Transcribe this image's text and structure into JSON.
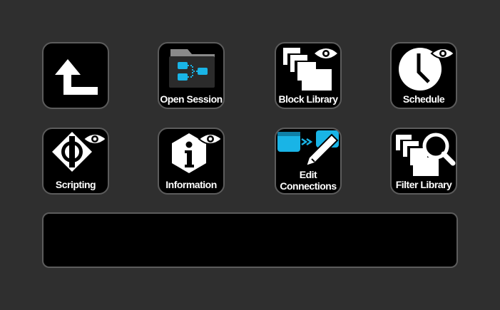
{
  "buttons": {
    "back": {
      "icon": "back-arrow-icon"
    },
    "open_session": {
      "label": "Open Session",
      "icon": "folder-flow-icon"
    },
    "block_library": {
      "label": "Block Library",
      "icon": "stacked-blocks-eye-icon"
    },
    "schedule": {
      "label": "Schedule",
      "icon": "clock-eye-icon"
    },
    "scripting": {
      "label": "Scripting",
      "icon": "script-eye-icon"
    },
    "information": {
      "label": "Information",
      "icon": "info-eye-icon"
    },
    "edit_connections": {
      "label_line1": "Edit",
      "label_line2": "Connections",
      "icon": "connections-pencil-icon"
    },
    "filter_library": {
      "label": "Filter Library",
      "icon": "stacked-blocks-magnifier-icon"
    }
  },
  "colors": {
    "background": "#2f2f2f",
    "key_fill": "#000000",
    "key_border": "#5c5c5c",
    "accent_cyan": "#19b4e6",
    "icon_white": "#ffffff"
  }
}
